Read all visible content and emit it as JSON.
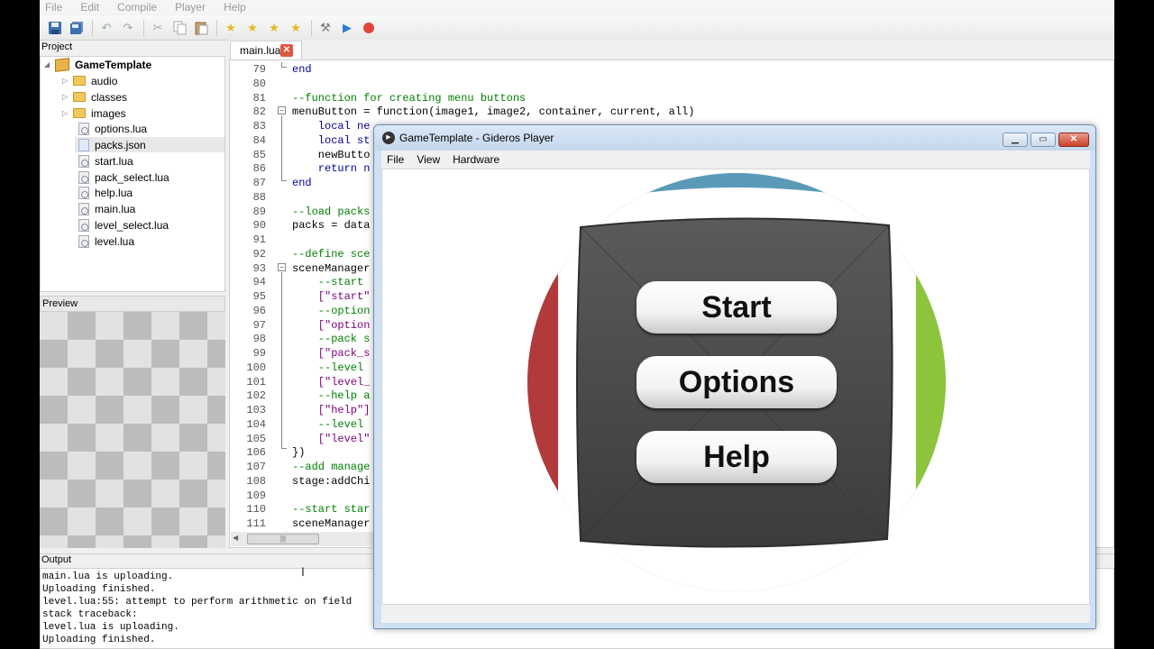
{
  "menubar": [
    "File",
    "Edit",
    "Compile",
    "Player",
    "Help"
  ],
  "toolbar": {
    "icons": [
      "save-icon",
      "save-all-icon",
      "undo-icon",
      "redo-icon",
      "cut-icon",
      "copy-icon",
      "paste-icon",
      "star-icon",
      "star-add-icon",
      "star-prev-icon",
      "star-next-icon",
      "export-icon",
      "play-icon",
      "stop-icon"
    ]
  },
  "project": {
    "header": "Project",
    "root": "GameTemplate",
    "folders": [
      "audio",
      "classes",
      "images"
    ],
    "files": [
      "options.lua",
      "packs.json",
      "start.lua",
      "pack_select.lua",
      "help.lua",
      "main.lua",
      "level_select.lua",
      "level.lua"
    ],
    "selected": "packs.json"
  },
  "preview": {
    "header": "Preview"
  },
  "editor": {
    "tab": "main.lua",
    "lines": [
      {
        "n": "79",
        "t": "end"
      },
      {
        "n": "80",
        "t": ""
      },
      {
        "n": "81",
        "t": "--function for creating menu buttons"
      },
      {
        "n": "82",
        "t": "menuButton = function(image1, image2, container, current, all)"
      },
      {
        "n": "83",
        "t": "    local ne"
      },
      {
        "n": "84",
        "t": "    local st"
      },
      {
        "n": "85",
        "t": "    newButto"
      },
      {
        "n": "86",
        "t": "    return n"
      },
      {
        "n": "87",
        "t": "end"
      },
      {
        "n": "88",
        "t": ""
      },
      {
        "n": "89",
        "t": "--load packs"
      },
      {
        "n": "90",
        "t": "packs = data"
      },
      {
        "n": "91",
        "t": ""
      },
      {
        "n": "92",
        "t": "--define sce"
      },
      {
        "n": "93",
        "t": "sceneManager"
      },
      {
        "n": "94",
        "t": "    --start"
      },
      {
        "n": "95",
        "t": "    [\"start\""
      },
      {
        "n": "96",
        "t": "    --option"
      },
      {
        "n": "97",
        "t": "    [\"option"
      },
      {
        "n": "98",
        "t": "    --pack s"
      },
      {
        "n": "99",
        "t": "    [\"pack_s"
      },
      {
        "n": "100",
        "t": "    --level"
      },
      {
        "n": "101",
        "t": "    [\"level_"
      },
      {
        "n": "102",
        "t": "    --help a"
      },
      {
        "n": "103",
        "t": "    [\"help\"]"
      },
      {
        "n": "104",
        "t": "    --level"
      },
      {
        "n": "105",
        "t": "    [\"level\""
      },
      {
        "n": "106",
        "t": "})"
      },
      {
        "n": "107",
        "t": "--add manage"
      },
      {
        "n": "108",
        "t": "stage:addChi"
      },
      {
        "n": "109",
        "t": ""
      },
      {
        "n": "110",
        "t": "--start star"
      },
      {
        "n": "111",
        "t": "sceneManager"
      }
    ]
  },
  "output": {
    "header": "Output",
    "lines": [
      "main.lua is uploading.",
      "Uploading finished.",
      "level.lua:55: attempt to perform arithmetic on field",
      "stack traceback:",
      "level.lua is uploading.",
      "Uploading finished."
    ]
  },
  "player": {
    "title": "GameTemplate - Gideros Player",
    "menu": [
      "File",
      "View",
      "Hardware"
    ],
    "buttons": [
      "Start",
      "Options",
      "Help"
    ],
    "colors": {
      "top": "#5a9ab8",
      "left": "#b23a3a",
      "right": "#8cc43c",
      "bottom": "#f39a12",
      "panel": "#4a4a4a"
    }
  }
}
